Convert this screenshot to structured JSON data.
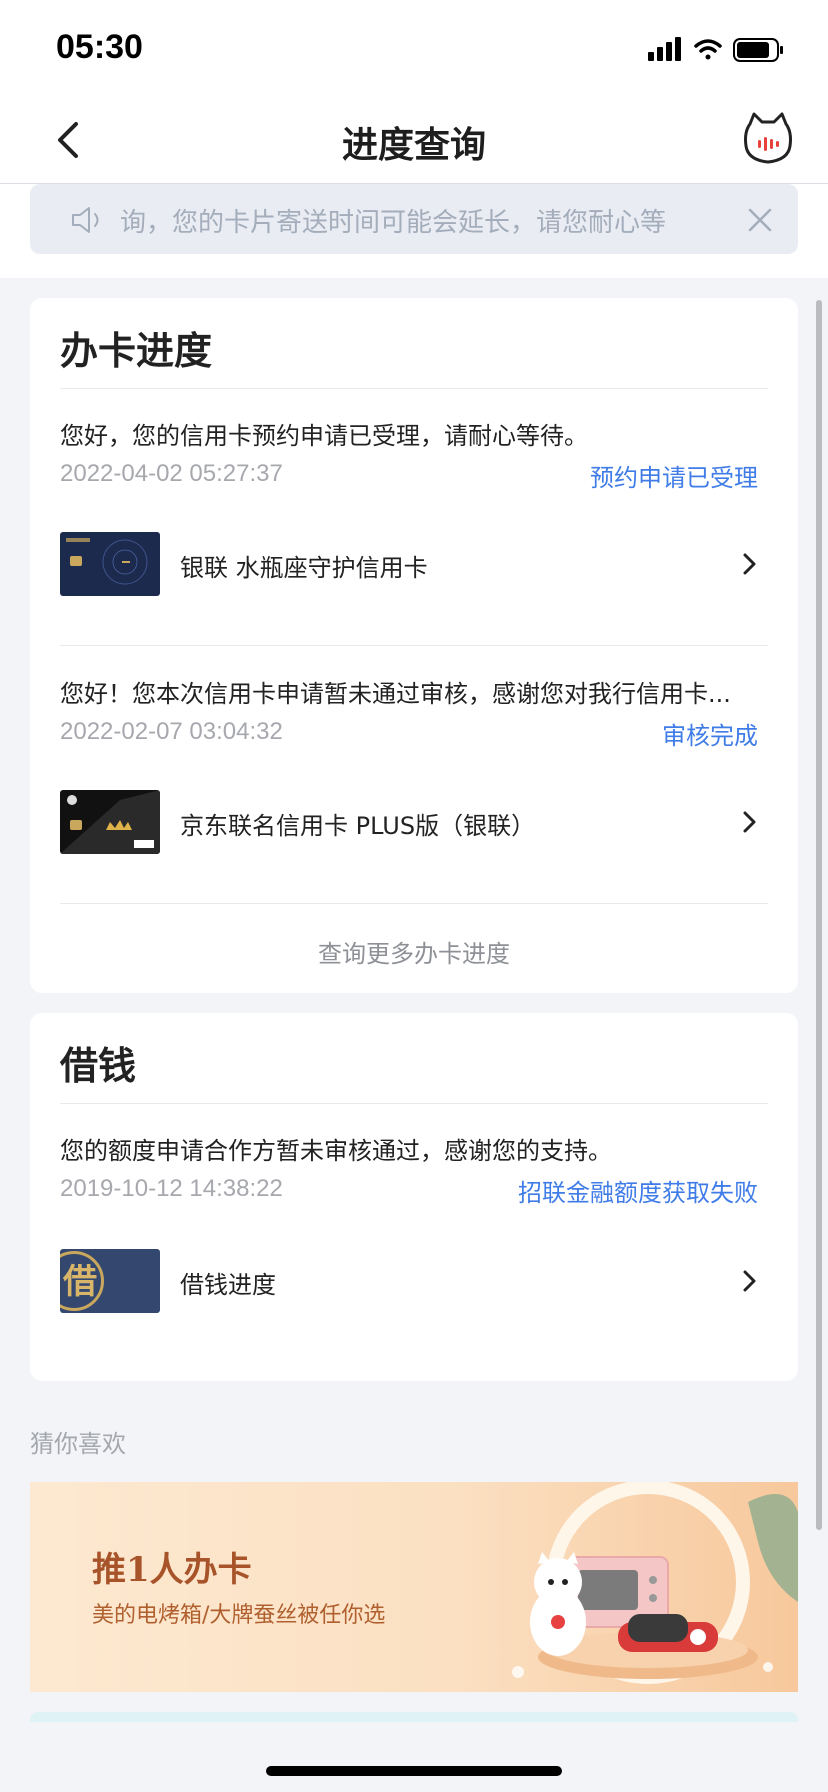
{
  "status_bar": {
    "time": "05:30"
  },
  "nav": {
    "title": "进度查询"
  },
  "notice": {
    "text": "询，您的卡片寄送时间可能会延长，请您耐心等"
  },
  "card_progress": {
    "title": "办卡进度",
    "items": [
      {
        "message": "您好，您的信用卡预约申请已受理，请耐心等待。",
        "time": "2022-04-02 05:27:37",
        "status": "预约申请已受理",
        "card_name": "银联 水瓶座守护信用卡"
      },
      {
        "message": "您好！您本次信用卡申请暂未通过审核，感谢您对我行信用卡...",
        "time": "2022-02-07 03:04:32",
        "status": "审核完成",
        "card_name": "京东联名信用卡 PLUS版（银联）"
      }
    ],
    "more_link": "查询更多办卡进度"
  },
  "card_loan": {
    "title": "借钱",
    "message": "您的额度申请合作方暂未审核通过，感谢您的支持。",
    "time": "2019-10-12 14:38:22",
    "status": "招联金融额度获取失败",
    "item_name": "借钱进度",
    "thumb_char": "借"
  },
  "recommend": {
    "label": "猜你喜欢",
    "banner_title": "推1人办卡",
    "banner_subtitle": "美的电烤箱/大牌蚕丝被任你选"
  },
  "colors": {
    "accent": "#3f7ce8",
    "background": "#f3f4f7"
  }
}
